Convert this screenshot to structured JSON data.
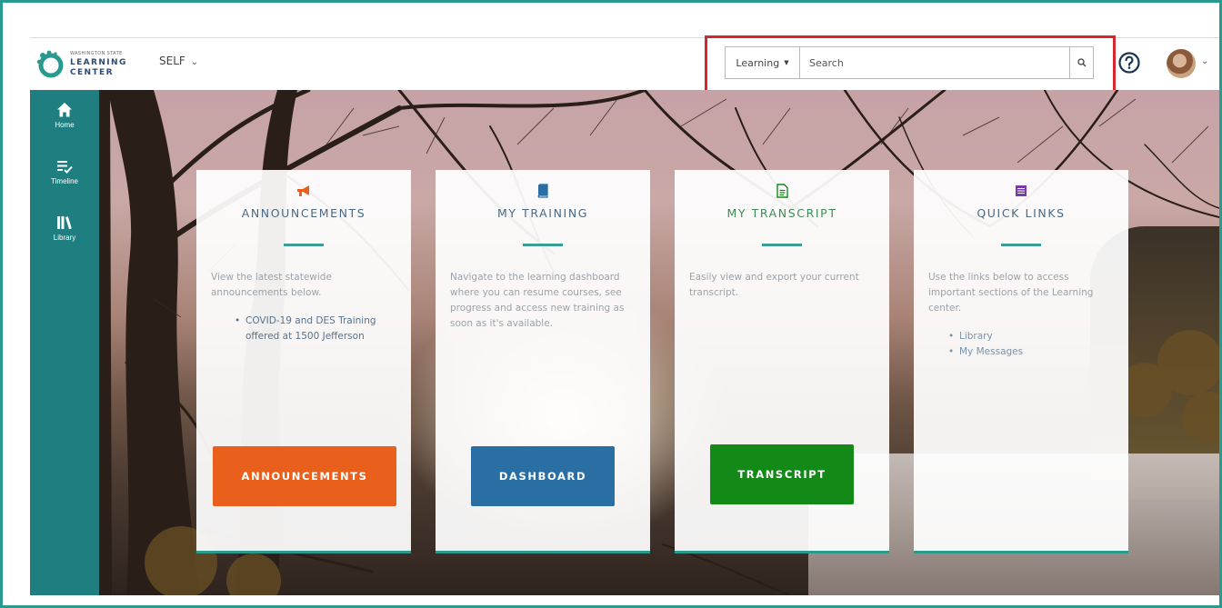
{
  "logo": {
    "small_text": "WASHINGTON STATE",
    "line1": "LEARNING",
    "line2": "CENTER"
  },
  "header": {
    "context_menu_label": "SELF",
    "search": {
      "scope_label": "Learning",
      "placeholder": "Search"
    }
  },
  "sidebar": {
    "items": [
      {
        "label": "Home",
        "icon": "home-icon"
      },
      {
        "label": "Timeline",
        "icon": "timeline-icon"
      },
      {
        "label": "Library",
        "icon": "library-icon"
      }
    ]
  },
  "cards": {
    "announcements": {
      "title": "ANNOUNCEMENTS",
      "description": "View the latest statewide announcements below.",
      "items": [
        "COVID-19 and DES Training offered at 1500 Jefferson"
      ],
      "button_label": "ANNOUNCEMENTS",
      "icon": "megaphone-icon",
      "accent_color": "#e8601c"
    },
    "my_training": {
      "title": "MY TRAINING",
      "description": "Navigate to the learning dashboard where you can resume courses, see progress and access new training as soon as it's available.",
      "button_label": "DASHBOARD",
      "icon": "book-icon",
      "accent_color": "#2a6fa4"
    },
    "my_transcript": {
      "title": "MY TRANSCRIPT",
      "description": "Easily view and export your current transcript.",
      "button_label": "TRANSCRIPT",
      "icon": "document-icon",
      "accent_color": "#138a17"
    },
    "quick_links": {
      "title": "QUICK LINKS",
      "description": "Use the links below to access important sections of the Learning center.",
      "items": [
        "Library",
        "My Messages"
      ],
      "icon": "list-icon",
      "accent_color": "#7a3aa8"
    }
  },
  "colors": {
    "sidebar": "#1f7f80",
    "frame_border": "#2a9a8e",
    "highlight": "#d9262c"
  }
}
